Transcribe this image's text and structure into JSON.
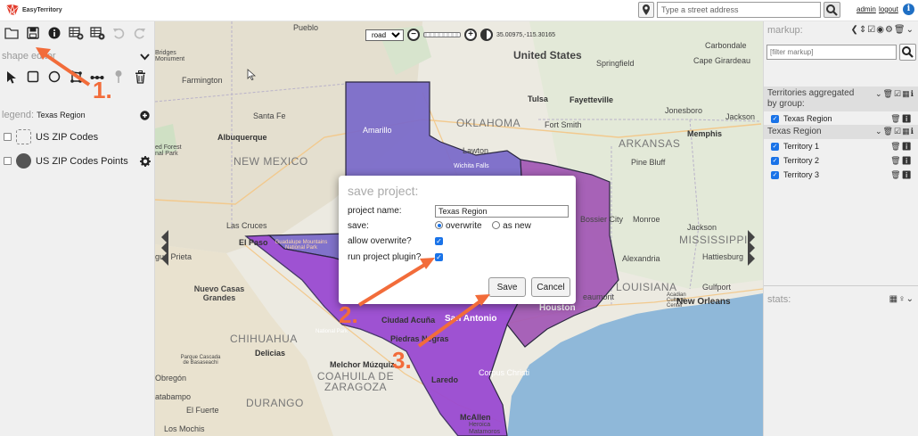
{
  "app": {
    "name": "EasyTerritory"
  },
  "topbar": {
    "address_placeholder": "Type a street address",
    "admin_label": "admin",
    "logout_label": "logout"
  },
  "left": {
    "shape_editor_label": "shape editor",
    "legend_prefix": "legend:",
    "legend_name": "Texas Region",
    "layers": [
      {
        "label": "US ZIP Codes"
      },
      {
        "label": "US ZIP Codes Points"
      }
    ]
  },
  "map": {
    "basemap_select": "road",
    "coordinates": "35.00975,-115.30165",
    "labels": {
      "united_states": "United States",
      "new_mexico": "NEW MEXICO",
      "oklahoma": "OKLAHOMA",
      "arkansas": "ARKANSAS",
      "mississippi": "MISSISSIPPI",
      "louisiana": "LOUISIANA",
      "chihuahua": "CHIHUAHUA",
      "coahuila": "COAHUILA DE ZARAGOZA",
      "durango": "DURANGO",
      "pueblo": "Pueblo",
      "farmington": "Farmington",
      "santa_fe": "Santa Fe",
      "albuquerque": "Albuquerque",
      "las_cruces": "Las Cruces",
      "el_paso": "El Paso",
      "amarillo": "Amarillo",
      "tulsa": "Tulsa",
      "fayetteville": "Fayetteville",
      "springfield": "Springfield",
      "carbondale": "Carbondale",
      "cape_girardeau": "Cape Girardeau",
      "jonesboro": "Jonesboro",
      "jackson_tn": "Jackson",
      "memphis": "Memphis",
      "fort_smith": "Fort Smith",
      "lawton": "Lawton",
      "wichita_falls": "Wichita Falls",
      "pine_bluff": "Pine Bluff",
      "monroe": "Monroe",
      "bossier_city": "Bossier City",
      "jackson_ms": "Jackson",
      "hattiesburg": "Hattiesburg",
      "alexandria": "Alexandria",
      "gulfport": "Gulfport",
      "new_orleans": "New Orleans",
      "houston": "Houston",
      "san_antonio": "San Antonio",
      "ciudad_acuna": "Ciudad Acuña",
      "piedras_negras": "Piedras Negras",
      "melchor_muzquiz": "Melchor Múzquiz",
      "laredo": "Laredo",
      "corpus_christi": "Corpus Christi",
      "mcallen": "McAllen",
      "heroica_matamoros": "Heroica Matamoros",
      "delicias": "Delicias",
      "nuevo_casas_grandes": "Nuevo Casas Grandes",
      "obregon": "Obregón",
      "el_fuerte": "El Fuerte",
      "los_mochis": "Los Mochis",
      "atabampo": "atabampo",
      "bridges_monument": "Bridges Monument",
      "ed_forest": "ed Forest nal Park",
      "jua_prieta": "gua Prieta",
      "guadalupe": "Guadalupe Mountains National Park",
      "national_park": "National Park",
      "parque": "Parque Cascada de Basaseachi",
      "acadian": "Acadian Cultural Center",
      "beaumont": "eaumont"
    }
  },
  "dialog": {
    "title": "save project:",
    "project_name_label": "project name:",
    "project_name_value": "Texas Region",
    "save_label": "save:",
    "overwrite_label": "overwrite",
    "as_new_label": "as new",
    "allow_overwrite_label": "allow overwrite?",
    "run_plugin_label": "run project plugin?",
    "save_button": "Save",
    "cancel_button": "Cancel",
    "save_mode": "overwrite",
    "allow_overwrite": true,
    "run_plugin": true
  },
  "annotations": {
    "step1": "1.",
    "step2": "2.",
    "step3": "3.",
    "color": "#f26c3a"
  },
  "right": {
    "markup_label": "markup:",
    "filter_placeholder": "[filter markup]",
    "aggregated_label": "Territories aggregated by group:",
    "aggregated_items": [
      {
        "label": "Texas Region"
      }
    ],
    "group_label": "Texas Region",
    "territories": [
      {
        "label": "Territory 1"
      },
      {
        "label": "Territory 2"
      },
      {
        "label": "Territory 3"
      }
    ],
    "stats_label": "stats:"
  },
  "colors": {
    "territory_1": "#7b6cc9",
    "territory_2": "#9a4ad1",
    "territory_3": "#a35bb5",
    "accent": "#1a73e8",
    "water": "#8fb8d9"
  }
}
